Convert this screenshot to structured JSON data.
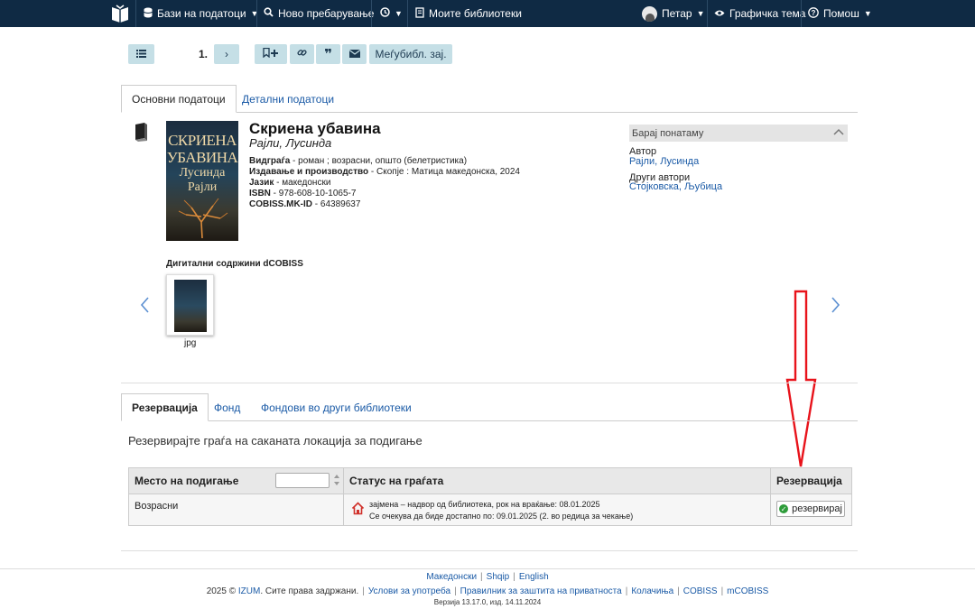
{
  "nav": {
    "databases_label": "Бази на податоци",
    "new_search_label": "Ново пребарување",
    "my_libraries_label": "Моите библиотеки",
    "user_label": "Петар",
    "graphic_theme_label": "Графичка тема",
    "help_label": "Помош"
  },
  "toolbar": {
    "record_number": "1.",
    "interlibrary_label": "Меѓубибл. зај."
  },
  "record_tabs": [
    "Основни податоци",
    "Детални податоци"
  ],
  "record": {
    "title": "Скриена убавина",
    "author": "Рајли, Лусинда",
    "cover_title_1": "СКРИЕНА",
    "cover_title_2": "УБАВИНА",
    "cover_author_1": "Лусинда",
    "cover_author_2": "Рајли",
    "fields": [
      {
        "label": "Видграѓа",
        "value": " - роман ; возрасни, општо (белетристика)"
      },
      {
        "label": "Издавање и производство",
        "value": " - Скопје : Матица македонска, 2024"
      },
      {
        "label": "Јазик",
        "value": " - македонски"
      },
      {
        "label": "ISBN",
        "value": " - 978-608-10-1065-7"
      },
      {
        "label": "COBISS.MK-ID",
        "value": " - 64389637"
      }
    ]
  },
  "further_search": {
    "heading": "Барај понатаму",
    "author_label": "Автор",
    "author_link": "Рајли, Лусинда",
    "other_authors_label": "Други автори",
    "other_authors_link": "Стојковска, Љубица"
  },
  "digital": {
    "heading": "Дигитални содржини dCOBISS",
    "file_type": "jpg"
  },
  "holdings_tabs": [
    "Резервација",
    "Фонд",
    "Фондови во други библиотеки"
  ],
  "reservation": {
    "intro": "Резервирајте граѓа на саканата локација за подигање",
    "columns": [
      "Место на подигање",
      "Статус на граѓата",
      "Резервација"
    ],
    "rows": [
      {
        "location": "Возрасни",
        "status_line_1": "зајмена – надвор од библиотека, рок на враќање: 08.01.2025",
        "status_line_2": "Се очекува да биде достапно по: 09.01.2025 (2. во редица за чекање)",
        "action": "резервирај"
      }
    ]
  },
  "footer": {
    "languages": [
      "Македонски",
      "Shqip",
      "English"
    ],
    "copyright": "2025 © ",
    "izum": "IZUM",
    "rights": ". Сите права задржани.",
    "links": [
      "Услови за употреба",
      "Правилник за заштита на приватноста",
      "Колачиња",
      "COBISS",
      "mCOBISS"
    ],
    "version": "Верзија 13.17.0, изд. 14.11.2024"
  },
  "colors": {
    "nav_bg": "#0f2a44",
    "button_bg": "#c5dfe6",
    "link": "#1a5aa6",
    "annotation_arrow": "#e8131b"
  }
}
